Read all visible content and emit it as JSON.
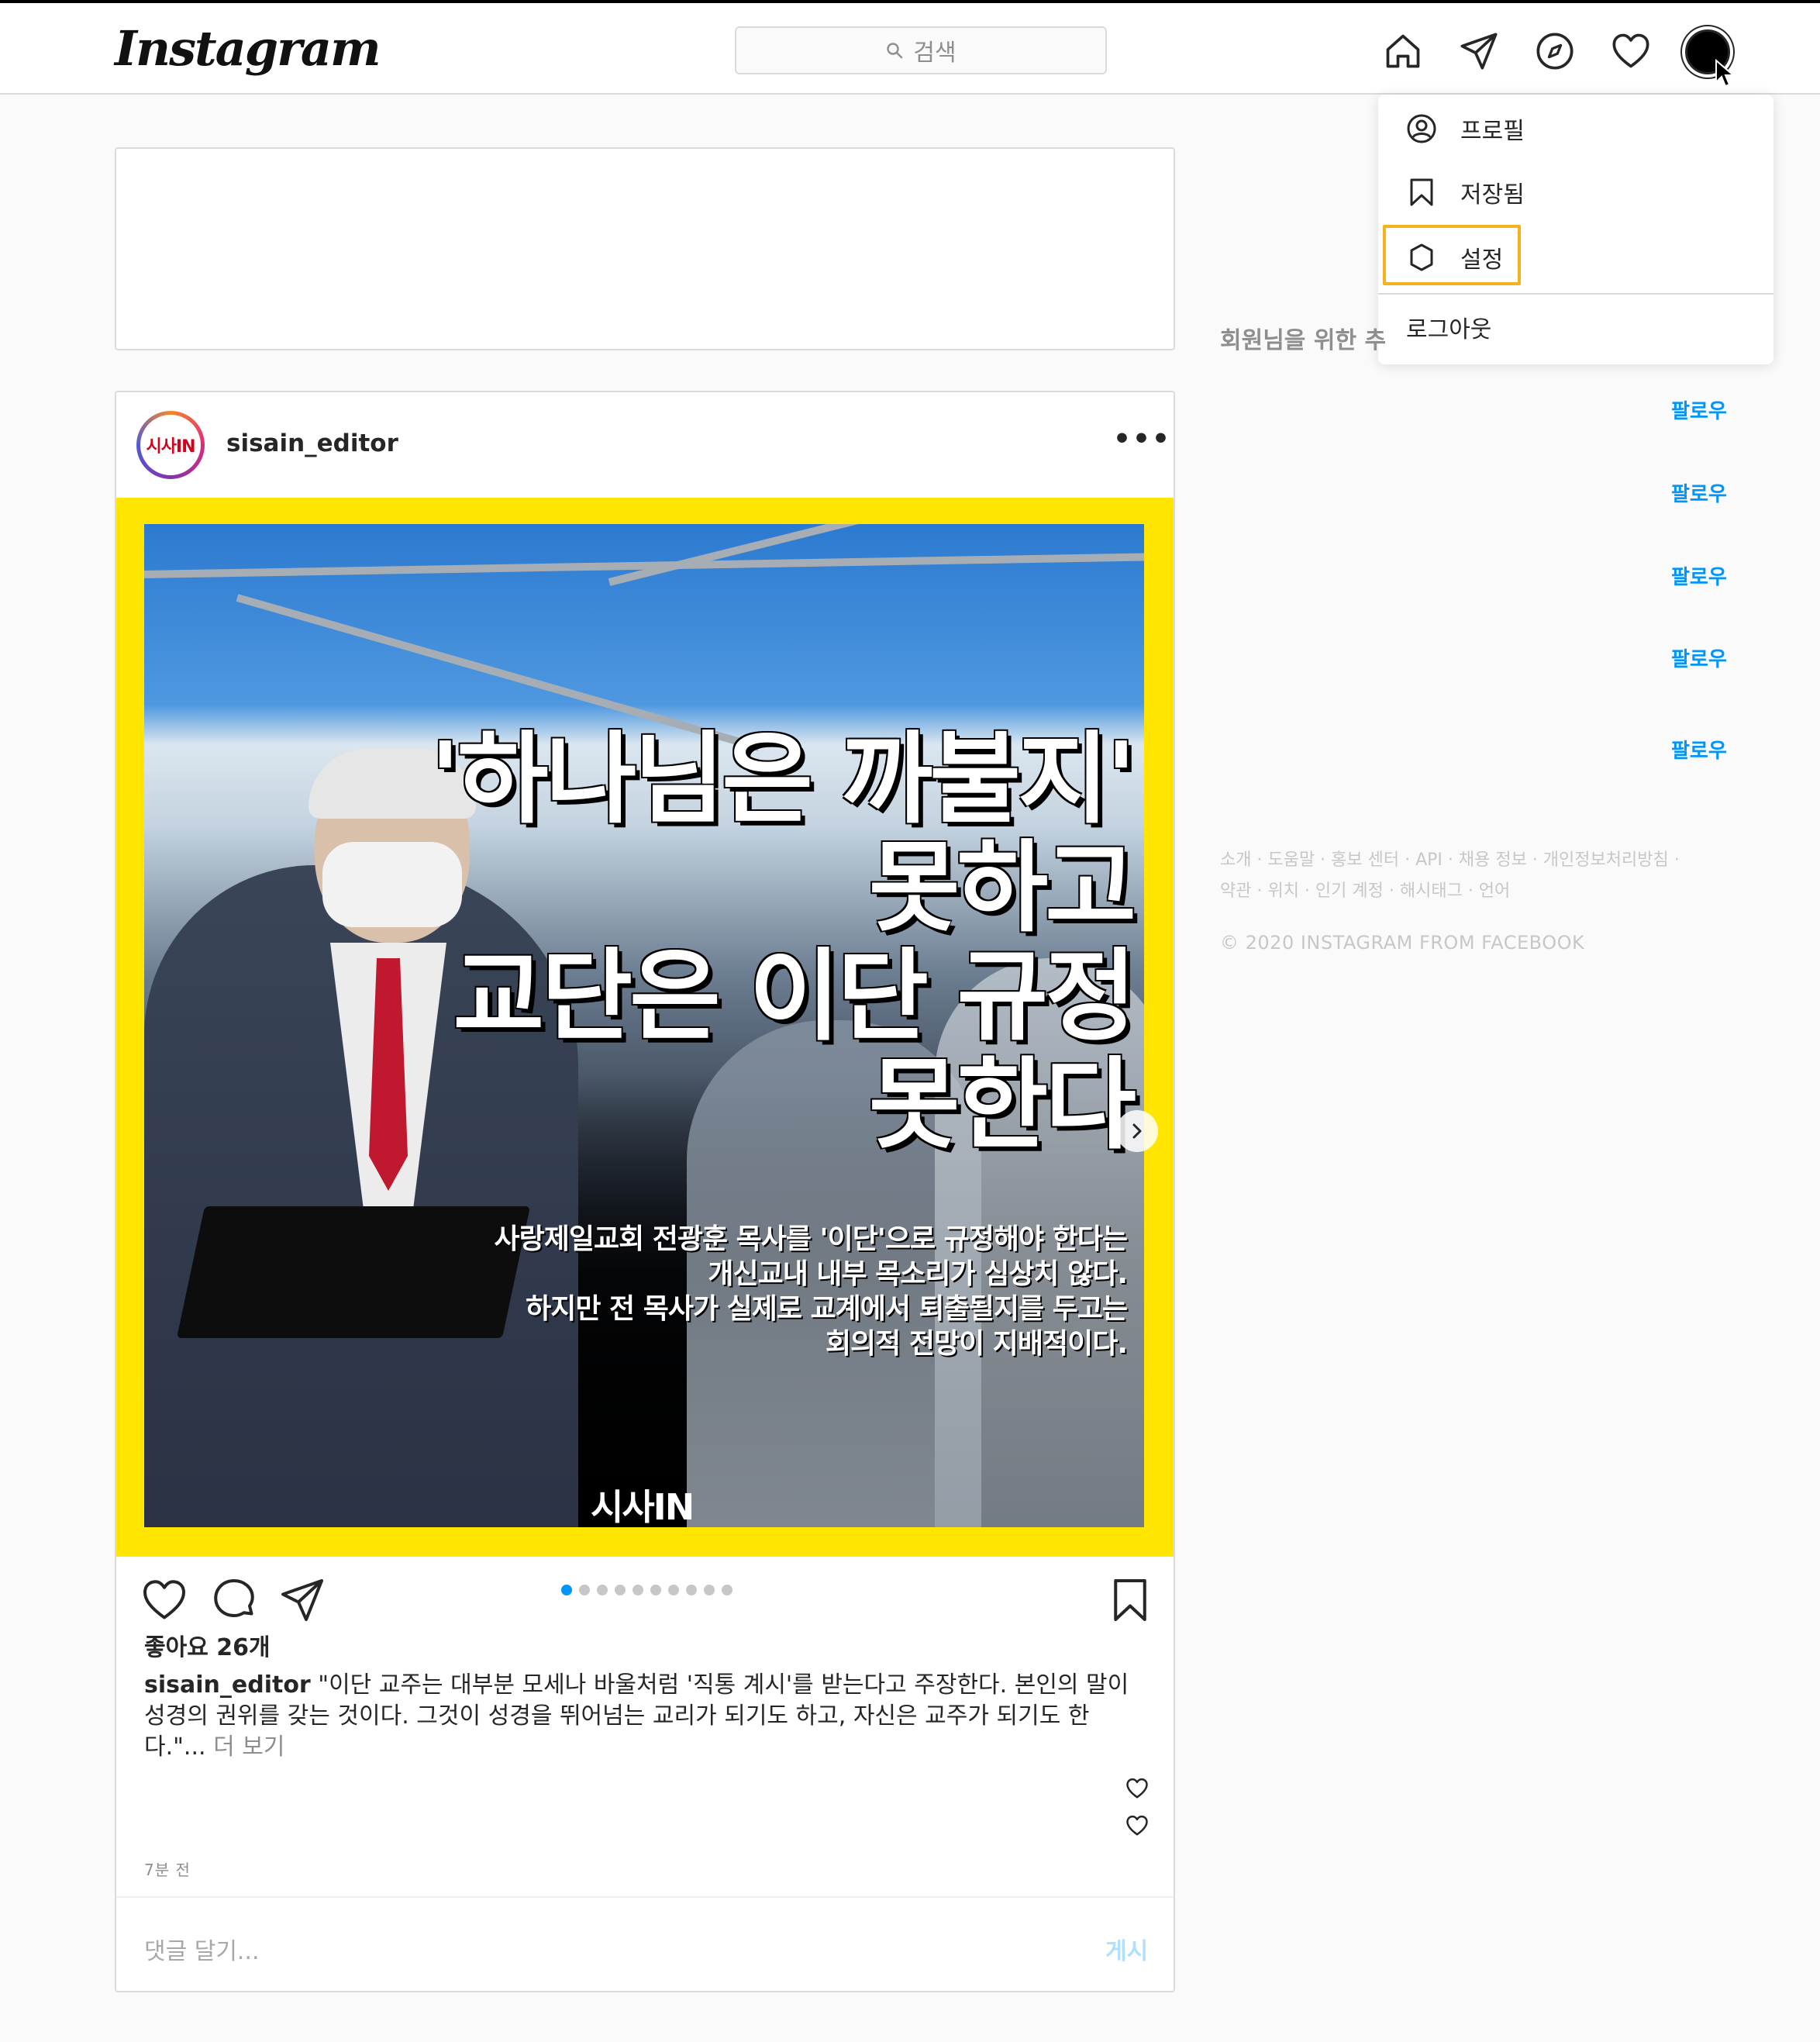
{
  "header": {
    "logo": "Instagram",
    "search_placeholder": "검색"
  },
  "profile_menu": {
    "items": [
      {
        "label": "프로필",
        "icon": "profile-circle-icon"
      },
      {
        "label": "저장됨",
        "icon": "bookmark-icon"
      },
      {
        "label": "설정",
        "icon": "settings-gear-icon"
      }
    ],
    "logout": "로그아웃"
  },
  "post": {
    "username": "sisain_editor",
    "avatar_text": "시사IN",
    "more_label": "•••",
    "image": {
      "headline": [
        "'하나님은 까불지'",
        "못하고",
        "교단은 이단 규정",
        "못한다"
      ],
      "subtext": [
        "사랑제일교회 전광훈 목사를 '이단'으로 규정해야 한다는",
        "개신교내 내부 목소리가 심상치 않다.",
        "하지만 전 목사가 실제로 교계에서 퇴출될지를 두고는",
        "회의적 전망이 지배적이다."
      ],
      "brand": "시사IN"
    },
    "carousel": {
      "count": 10,
      "active": 0
    },
    "likes": "좋아요 26개",
    "caption_user": "sisain_editor",
    "caption_text": " \"이단 교주는 대부분 모세나 바울처럼 '직통 계시'를 받는다고 주장한다. 본인의 말이 성경의 권위를 갖는 것이다. 그것이 성경을 뛰어넘는 교리가 되기도 하고, 자신은 교주가 되기도 한 다.\"...",
    "caption_more": " 더 보기",
    "time": "7분 전",
    "comment_placeholder": "댓글 달기...",
    "post_button": "게시"
  },
  "sidebar": {
    "suggestions_title": "회원님을 위한 추",
    "follow_label": "팔로우",
    "footer_line1": "소개 · 도움말 · 홍보 센터 · API · 채용 정보 · 개인정보처리방침 ·",
    "footer_line2": "약관 · 위치 · 인기 계정 · 해시태그 · 언어",
    "copyright": "© 2020 INSTAGRAM FROM FACEBOOK"
  },
  "colors": {
    "accent": "#0095f6",
    "highlight": "#f5b21f",
    "post_frame": "#ffe500"
  }
}
